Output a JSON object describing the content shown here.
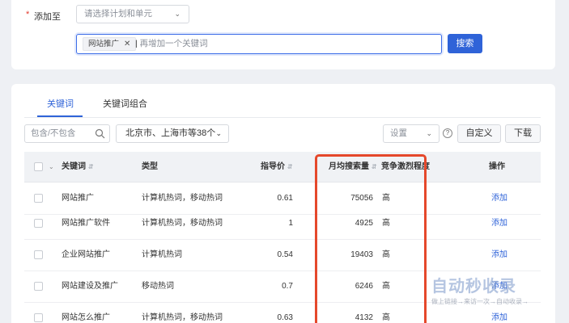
{
  "add_to": {
    "required_mark": "*",
    "label": "添加至",
    "plan_placeholder": "请选择计划和单元"
  },
  "keyword_input": {
    "tag": "网站推广",
    "placeholder": "再增加一个关键词"
  },
  "search_button": "搜索",
  "tabs": [
    "关键词",
    "关键词组合"
  ],
  "filters": {
    "include_placeholder": "包含/不包含",
    "region": "北京市、上海市等38个",
    "settings": "设置",
    "custom": "自定义",
    "download": "下载"
  },
  "table": {
    "headers": {
      "keyword": "关键词",
      "type": "类型",
      "price": "指导价",
      "volume": "月均搜索量",
      "competition": "竞争激烈程度",
      "action": "操作"
    },
    "rows": [
      {
        "keyword": "网站推广",
        "type": "计算机热词，移动热词",
        "price": "0.61",
        "volume": "75056",
        "competition": "高",
        "action": "添加"
      },
      {
        "keyword": "网站推广软件",
        "type": "计算机热词，移动热词",
        "price": "1",
        "volume": "4925",
        "competition": "高",
        "action": "添加"
      },
      {
        "keyword": "企业网站推广",
        "type": "计算机热词",
        "price": "0.54",
        "volume": "19403",
        "competition": "高",
        "action": "添加"
      },
      {
        "keyword": "网站建设及推广",
        "type": "移动热词",
        "price": "0.7",
        "volume": "6246",
        "competition": "高",
        "action": "添加"
      },
      {
        "keyword": "网站怎么推广",
        "type": "计算机热词，移动热词",
        "price": "0.63",
        "volume": "4132",
        "competition": "高",
        "action": "添加"
      }
    ]
  },
  "watermark": {
    "logo": "自动秒收录",
    "tagline": "做上链接→来访一次→自动收录→"
  },
  "colors": {
    "accent": "#2f63d8",
    "highlight": "#e5482b",
    "required": "#e23b2e"
  }
}
